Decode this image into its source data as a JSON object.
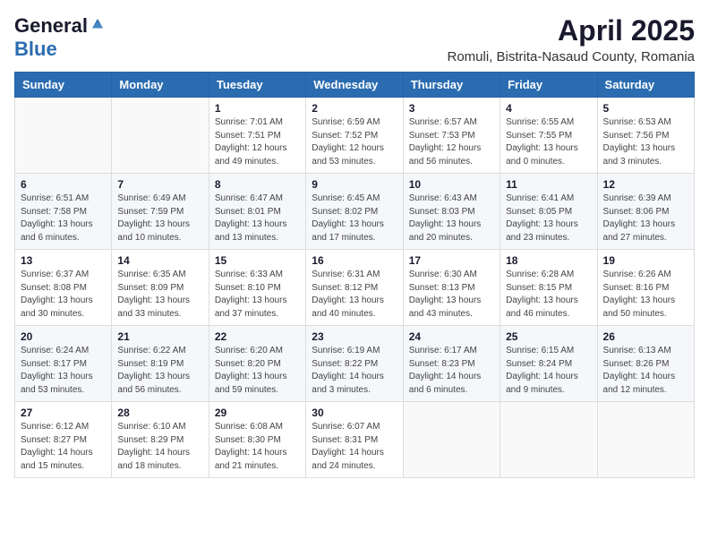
{
  "header": {
    "logo_general": "General",
    "logo_blue": "Blue",
    "month": "April 2025",
    "location": "Romuli, Bistrita-Nasaud County, Romania"
  },
  "days_of_week": [
    "Sunday",
    "Monday",
    "Tuesday",
    "Wednesday",
    "Thursday",
    "Friday",
    "Saturday"
  ],
  "weeks": [
    [
      {
        "day": null
      },
      {
        "day": null
      },
      {
        "day": "1",
        "sunrise": "Sunrise: 7:01 AM",
        "sunset": "Sunset: 7:51 PM",
        "daylight": "Daylight: 12 hours and 49 minutes."
      },
      {
        "day": "2",
        "sunrise": "Sunrise: 6:59 AM",
        "sunset": "Sunset: 7:52 PM",
        "daylight": "Daylight: 12 hours and 53 minutes."
      },
      {
        "day": "3",
        "sunrise": "Sunrise: 6:57 AM",
        "sunset": "Sunset: 7:53 PM",
        "daylight": "Daylight: 12 hours and 56 minutes."
      },
      {
        "day": "4",
        "sunrise": "Sunrise: 6:55 AM",
        "sunset": "Sunset: 7:55 PM",
        "daylight": "Daylight: 13 hours and 0 minutes."
      },
      {
        "day": "5",
        "sunrise": "Sunrise: 6:53 AM",
        "sunset": "Sunset: 7:56 PM",
        "daylight": "Daylight: 13 hours and 3 minutes."
      }
    ],
    [
      {
        "day": "6",
        "sunrise": "Sunrise: 6:51 AM",
        "sunset": "Sunset: 7:58 PM",
        "daylight": "Daylight: 13 hours and 6 minutes."
      },
      {
        "day": "7",
        "sunrise": "Sunrise: 6:49 AM",
        "sunset": "Sunset: 7:59 PM",
        "daylight": "Daylight: 13 hours and 10 minutes."
      },
      {
        "day": "8",
        "sunrise": "Sunrise: 6:47 AM",
        "sunset": "Sunset: 8:01 PM",
        "daylight": "Daylight: 13 hours and 13 minutes."
      },
      {
        "day": "9",
        "sunrise": "Sunrise: 6:45 AM",
        "sunset": "Sunset: 8:02 PM",
        "daylight": "Daylight: 13 hours and 17 minutes."
      },
      {
        "day": "10",
        "sunrise": "Sunrise: 6:43 AM",
        "sunset": "Sunset: 8:03 PM",
        "daylight": "Daylight: 13 hours and 20 minutes."
      },
      {
        "day": "11",
        "sunrise": "Sunrise: 6:41 AM",
        "sunset": "Sunset: 8:05 PM",
        "daylight": "Daylight: 13 hours and 23 minutes."
      },
      {
        "day": "12",
        "sunrise": "Sunrise: 6:39 AM",
        "sunset": "Sunset: 8:06 PM",
        "daylight": "Daylight: 13 hours and 27 minutes."
      }
    ],
    [
      {
        "day": "13",
        "sunrise": "Sunrise: 6:37 AM",
        "sunset": "Sunset: 8:08 PM",
        "daylight": "Daylight: 13 hours and 30 minutes."
      },
      {
        "day": "14",
        "sunrise": "Sunrise: 6:35 AM",
        "sunset": "Sunset: 8:09 PM",
        "daylight": "Daylight: 13 hours and 33 minutes."
      },
      {
        "day": "15",
        "sunrise": "Sunrise: 6:33 AM",
        "sunset": "Sunset: 8:10 PM",
        "daylight": "Daylight: 13 hours and 37 minutes."
      },
      {
        "day": "16",
        "sunrise": "Sunrise: 6:31 AM",
        "sunset": "Sunset: 8:12 PM",
        "daylight": "Daylight: 13 hours and 40 minutes."
      },
      {
        "day": "17",
        "sunrise": "Sunrise: 6:30 AM",
        "sunset": "Sunset: 8:13 PM",
        "daylight": "Daylight: 13 hours and 43 minutes."
      },
      {
        "day": "18",
        "sunrise": "Sunrise: 6:28 AM",
        "sunset": "Sunset: 8:15 PM",
        "daylight": "Daylight: 13 hours and 46 minutes."
      },
      {
        "day": "19",
        "sunrise": "Sunrise: 6:26 AM",
        "sunset": "Sunset: 8:16 PM",
        "daylight": "Daylight: 13 hours and 50 minutes."
      }
    ],
    [
      {
        "day": "20",
        "sunrise": "Sunrise: 6:24 AM",
        "sunset": "Sunset: 8:17 PM",
        "daylight": "Daylight: 13 hours and 53 minutes."
      },
      {
        "day": "21",
        "sunrise": "Sunrise: 6:22 AM",
        "sunset": "Sunset: 8:19 PM",
        "daylight": "Daylight: 13 hours and 56 minutes."
      },
      {
        "day": "22",
        "sunrise": "Sunrise: 6:20 AM",
        "sunset": "Sunset: 8:20 PM",
        "daylight": "Daylight: 13 hours and 59 minutes."
      },
      {
        "day": "23",
        "sunrise": "Sunrise: 6:19 AM",
        "sunset": "Sunset: 8:22 PM",
        "daylight": "Daylight: 14 hours and 3 minutes."
      },
      {
        "day": "24",
        "sunrise": "Sunrise: 6:17 AM",
        "sunset": "Sunset: 8:23 PM",
        "daylight": "Daylight: 14 hours and 6 minutes."
      },
      {
        "day": "25",
        "sunrise": "Sunrise: 6:15 AM",
        "sunset": "Sunset: 8:24 PM",
        "daylight": "Daylight: 14 hours and 9 minutes."
      },
      {
        "day": "26",
        "sunrise": "Sunrise: 6:13 AM",
        "sunset": "Sunset: 8:26 PM",
        "daylight": "Daylight: 14 hours and 12 minutes."
      }
    ],
    [
      {
        "day": "27",
        "sunrise": "Sunrise: 6:12 AM",
        "sunset": "Sunset: 8:27 PM",
        "daylight": "Daylight: 14 hours and 15 minutes."
      },
      {
        "day": "28",
        "sunrise": "Sunrise: 6:10 AM",
        "sunset": "Sunset: 8:29 PM",
        "daylight": "Daylight: 14 hours and 18 minutes."
      },
      {
        "day": "29",
        "sunrise": "Sunrise: 6:08 AM",
        "sunset": "Sunset: 8:30 PM",
        "daylight": "Daylight: 14 hours and 21 minutes."
      },
      {
        "day": "30",
        "sunrise": "Sunrise: 6:07 AM",
        "sunset": "Sunset: 8:31 PM",
        "daylight": "Daylight: 14 hours and 24 minutes."
      },
      {
        "day": null
      },
      {
        "day": null
      },
      {
        "day": null
      }
    ]
  ]
}
